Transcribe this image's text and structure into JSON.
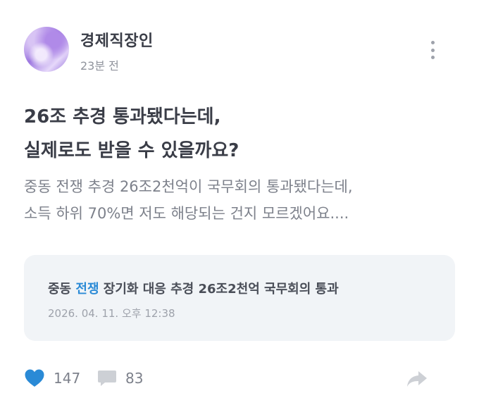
{
  "post": {
    "author": "경제직장인",
    "time": "23분 전",
    "title_lines": [
      "26조 추경 통과됐다는데,",
      "실제로도 받을 수 있을까요?"
    ],
    "body_lines": [
      "중동 전쟁 추경 26조2천억이 국무회의 통과됐다는데,",
      "소득 하위 70%면 저도 해당되는 건지 모르겠어요...."
    ]
  },
  "news_card": {
    "title_prefix": "중동 ",
    "title_highlight": "전쟁",
    "title_suffix": " 장기화 대응 추경 26조2천억 국무회의 통과",
    "date": "2026. 04. 11. 오후 12:38"
  },
  "actions": {
    "like_count": "147",
    "comment_count": "83"
  },
  "icons": {
    "more": "more-vertical-icon",
    "like": "heart-icon",
    "comment": "speech-bubble-icon",
    "share": "share-arrow-icon"
  },
  "colors": {
    "accent": "#2a8ad6",
    "heart": "#2a8ad6",
    "text_primary": "#3a3d47",
    "text_secondary": "#7d818b",
    "card_bg": "#f1f4f7"
  }
}
